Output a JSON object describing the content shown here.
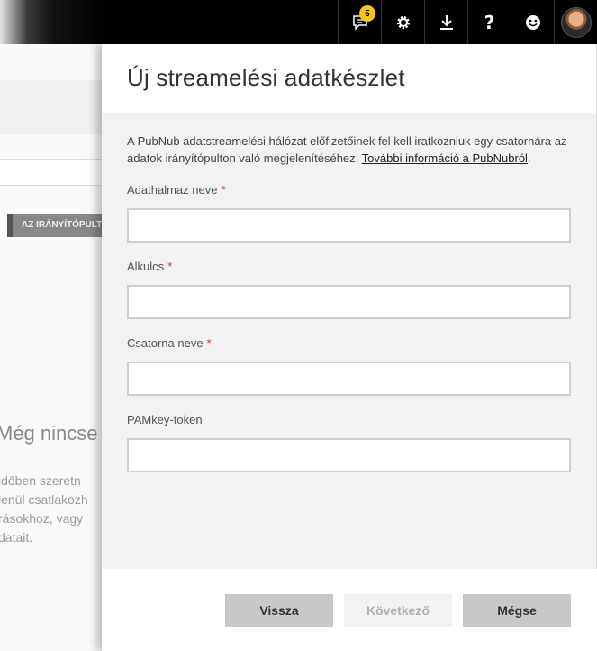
{
  "topbar": {
    "notification_count": "5",
    "icons": [
      "notifications-icon",
      "settings-icon",
      "download-icon",
      "help-icon",
      "feedback-icon",
      "avatar"
    ],
    "help_glyph": "?"
  },
  "background": {
    "dashboard_button": "AZ IRÁNYÍTÓPULT",
    "heading": "Még nincse",
    "lines": [
      "időben szeretn",
      "lenül csatlakozh",
      "rásokhoz, vagy",
      "datait."
    ]
  },
  "panel": {
    "title": "Új streamelési adatkészlet",
    "description": "A PubNub adatstreamelési hálózat előfizetőinek fel kell iratkozniuk egy csatornára az adatok irányítópulton való megjelenítéséhez.",
    "description_link": "További információ a PubNubról",
    "description_end": ".",
    "fields": [
      {
        "label": "Adathalmaz neve",
        "required": "*",
        "value": ""
      },
      {
        "label": "Alkulcs",
        "required": "*",
        "value": ""
      },
      {
        "label": "Csatorna neve",
        "required": "*",
        "value": ""
      },
      {
        "label": "PAMkey-token",
        "required": "",
        "value": ""
      }
    ],
    "buttons": {
      "back": "Vissza",
      "next": "Következő",
      "cancel": "Mégse"
    }
  },
  "colors": {
    "topbar": "#000000",
    "badge": "#f2c811",
    "required": "#c0392b",
    "panel_bg": "#f2f2f2",
    "button_bg": "#c8c8c8"
  }
}
